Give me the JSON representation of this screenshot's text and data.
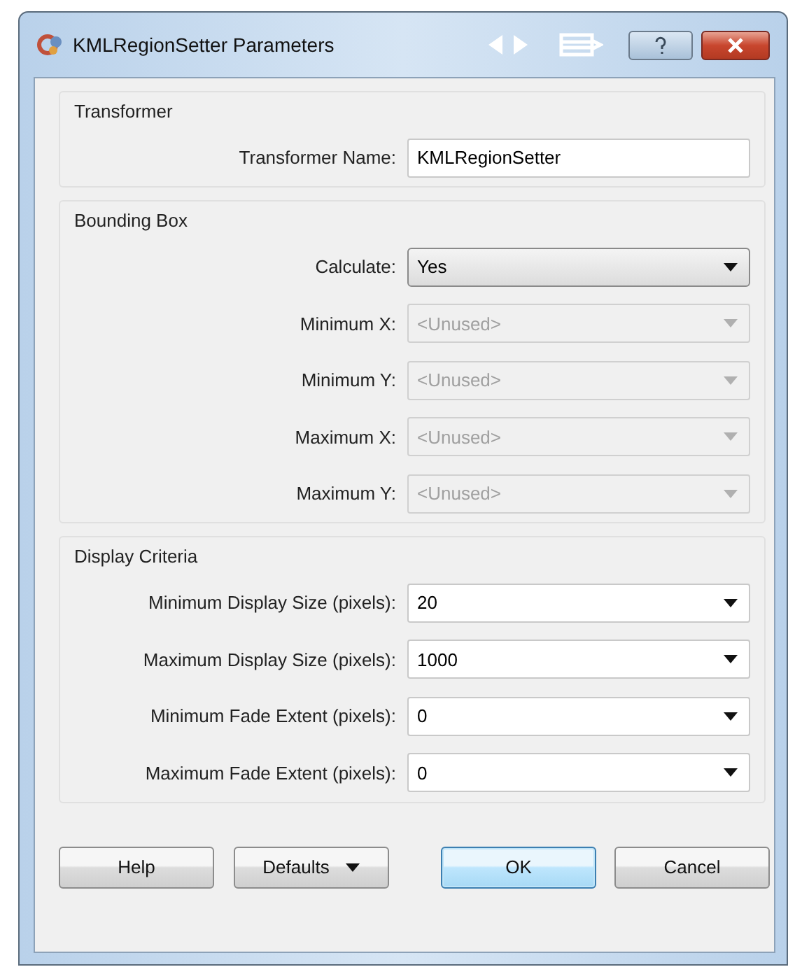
{
  "window": {
    "title": "KMLRegionSetter Parameters"
  },
  "groups": [
    {
      "title": "Transformer",
      "fields": [
        {
          "label": "Transformer Name:",
          "kind": "text",
          "value": "KMLRegionSetter",
          "disabled": false
        }
      ]
    },
    {
      "title": "Bounding Box",
      "fields": [
        {
          "label": "Calculate:",
          "kind": "choice",
          "value": "Yes",
          "disabled": false
        },
        {
          "label": "Minimum X:",
          "kind": "combo",
          "value": "<Unused>",
          "disabled": true
        },
        {
          "label": "Minimum Y:",
          "kind": "combo",
          "value": "<Unused>",
          "disabled": true
        },
        {
          "label": "Maximum X:",
          "kind": "combo",
          "value": "<Unused>",
          "disabled": true
        },
        {
          "label": "Maximum Y:",
          "kind": "combo",
          "value": "<Unused>",
          "disabled": true
        }
      ]
    },
    {
      "title": "Display Criteria",
      "fields": [
        {
          "label": "Minimum Display Size (pixels):",
          "kind": "combo",
          "value": "20",
          "disabled": false
        },
        {
          "label": "Maximum Display Size (pixels):",
          "kind": "combo",
          "value": "1000",
          "disabled": false
        },
        {
          "label": "Minimum Fade Extent (pixels):",
          "kind": "combo",
          "value": "0",
          "disabled": false
        },
        {
          "label": "Maximum Fade Extent (pixels):",
          "kind": "combo",
          "value": "0",
          "disabled": false
        }
      ]
    }
  ],
  "buttons": [
    {
      "label": "Help",
      "kind": "plain",
      "default": false
    },
    {
      "label": "Defaults",
      "kind": "menu",
      "default": false
    },
    {
      "label": "OK",
      "kind": "plain",
      "default": true
    },
    {
      "label": "Cancel",
      "kind": "plain",
      "default": false
    }
  ]
}
